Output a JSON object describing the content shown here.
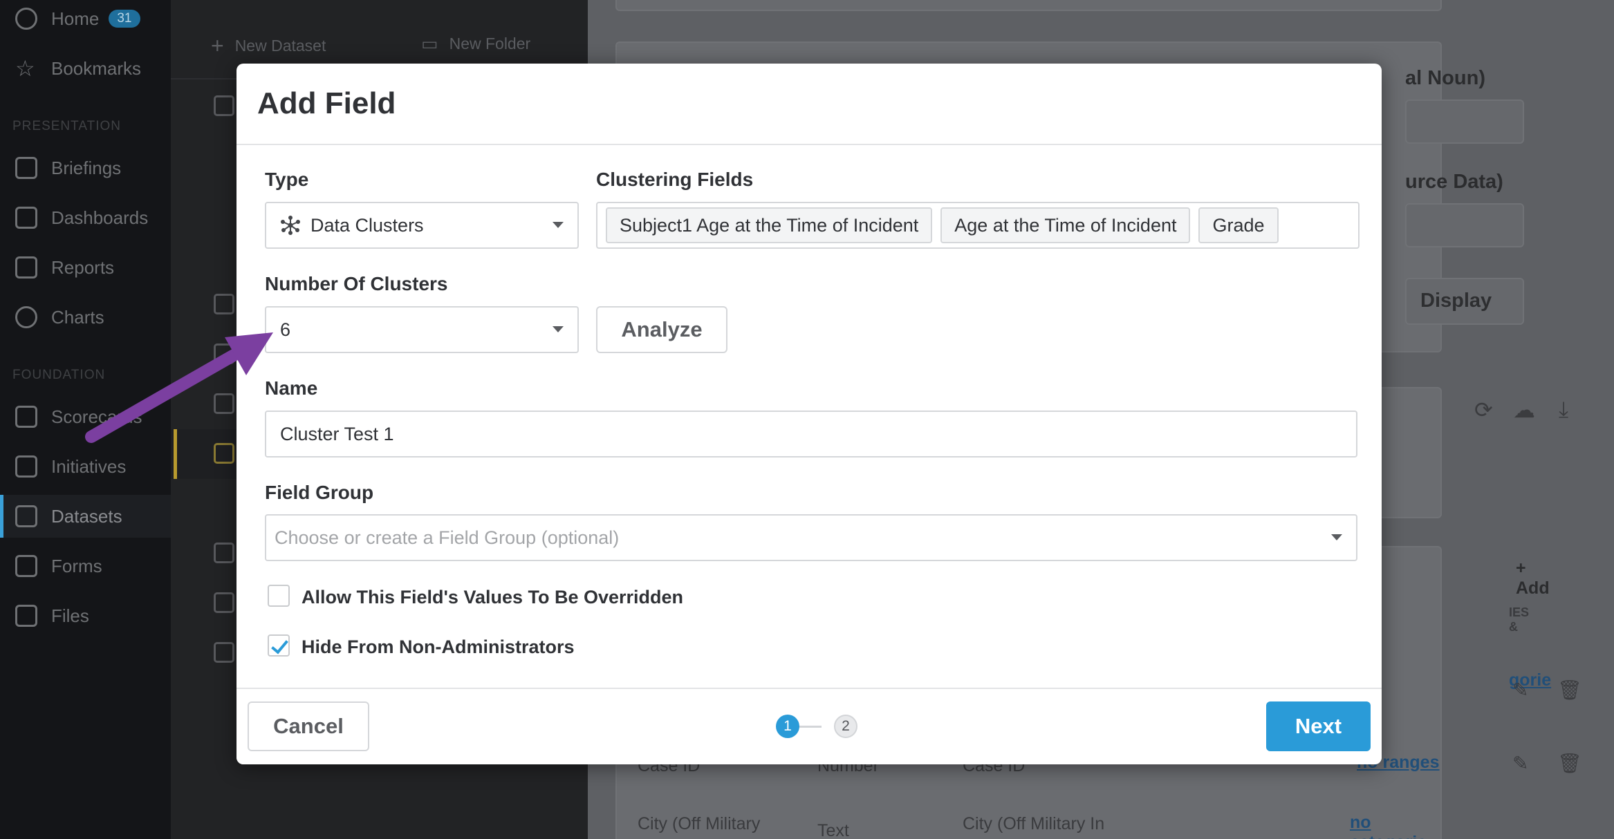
{
  "sidebar": {
    "home_label": "Home",
    "home_badge": "31",
    "bookmarks_label": "Bookmarks",
    "section_presentation": "PRESENTATION",
    "briefings_label": "Briefings",
    "dashboards_label": "Dashboards",
    "reports_label": "Reports",
    "charts_label": "Charts",
    "section_foundation": "FOUNDATION",
    "scorecards_label": "Scorecards",
    "initiatives_label": "Initiatives",
    "datasets_label": "Datasets",
    "forms_label": "Forms",
    "files_label": "Files"
  },
  "midpanel": {
    "new_dataset_label": "New Dataset",
    "new_folder_label": "New Folder"
  },
  "background": {
    "noun_label": "al Noun)",
    "source_data_label": "urce Data)",
    "display_label": "Display",
    "add_label": "Add",
    "col_header_fragment": "IES &",
    "row1_link": "gorie",
    "row2_col1": "Case ID",
    "row2_col2": "Number",
    "row2_col3": "Case ID",
    "row2_link": "no ranges",
    "row3_col1": "City (Off Military",
    "row3_col2": "Text",
    "row3_col3": "City (Off Military In",
    "row3_link": "no categorie"
  },
  "modal": {
    "title": "Add Field",
    "type_label": "Type",
    "type_value": "Data Clusters",
    "type_icon": "cluster-icon",
    "clustering_fields_label": "Clustering Fields",
    "clustering_fields": [
      "Subject1 Age at the Time of Incident",
      "Age at the Time of Incident",
      "Grade"
    ],
    "clusters_label": "Number Of Clusters",
    "clusters_value": "6",
    "analyze_label": "Analyze",
    "name_label": "Name",
    "name_value": "Cluster Test 1",
    "field_group_label": "Field Group",
    "field_group_placeholder": "Choose or create a Field Group (optional)",
    "allow_override_label": "Allow This Field's Values To Be Overridden",
    "allow_override_checked": false,
    "hide_label": "Hide From Non-Administrators",
    "hide_checked": true,
    "cancel_label": "Cancel",
    "next_label": "Next",
    "steps": [
      "1",
      "2"
    ]
  },
  "colors": {
    "accent": "#2a9bd8",
    "annotation_arrow": "#7b3fa0",
    "overlay": "#2a2b2e"
  }
}
